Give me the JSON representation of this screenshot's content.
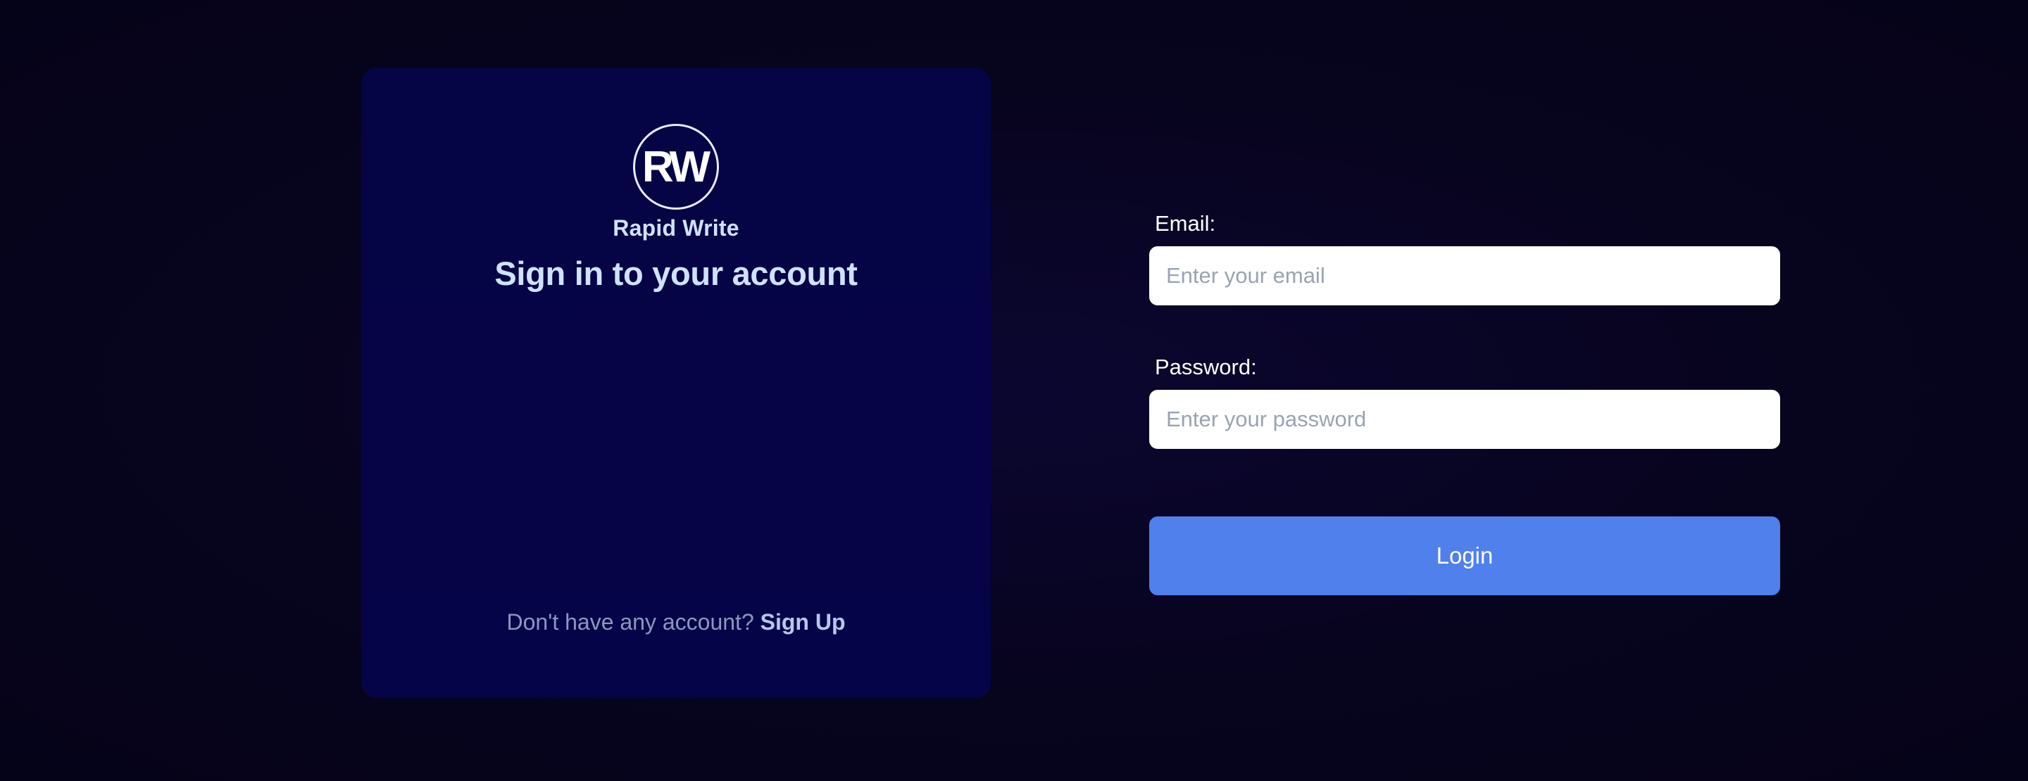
{
  "brand": {
    "logo_text": "RW",
    "name": "Rapid Write"
  },
  "card": {
    "title": "Sign in to your account",
    "signup_prompt": "Don't have any account?",
    "signup_link": "Sign Up"
  },
  "form": {
    "email_label": "Email:",
    "email_placeholder": "Enter your email",
    "email_value": "",
    "password_label": "Password:",
    "password_placeholder": "Enter your password",
    "password_value": "",
    "login_label": "Login"
  },
  "colors": {
    "background": "#07041e",
    "card": "#050444",
    "accent": "#4f80ec",
    "heading": "#cfe2ff"
  }
}
